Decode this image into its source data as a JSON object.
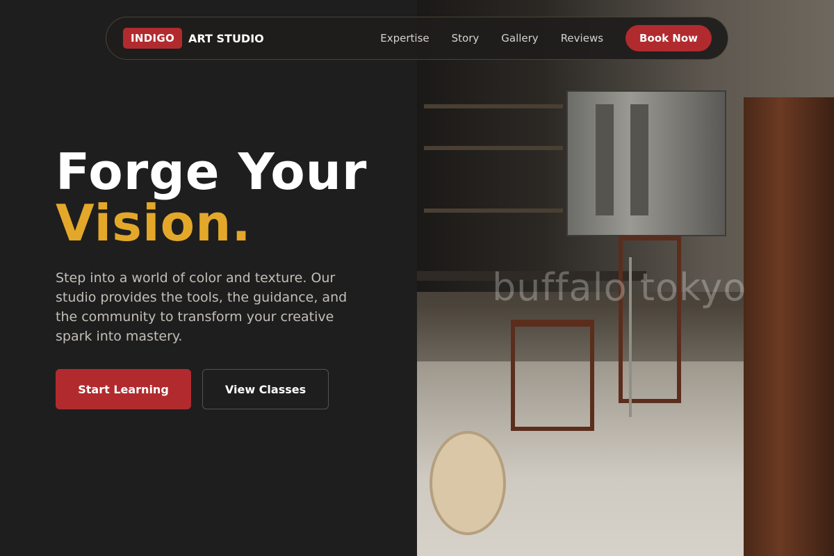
{
  "brand": {
    "badge": "INDIGO",
    "name": "ART STUDIO"
  },
  "nav": {
    "links": [
      "Expertise",
      "Story",
      "Gallery",
      "Reviews"
    ],
    "cta": "Book Now"
  },
  "hero": {
    "title_line1": "Forge Your",
    "title_line2": "Vision.",
    "description": "Step into a world of color and texture. Our studio provides the tools, the guidance, and the community to transform your creative spark into mastery.",
    "primary_button": "Start Learning",
    "secondary_button": "View Classes"
  },
  "photo": {
    "watermark": "buffalo tokyo"
  },
  "colors": {
    "background": "#1f1e1e",
    "accent_red": "#b12b2e",
    "accent_gold": "#e3a82a",
    "text_muted": "#c3bfb9"
  }
}
